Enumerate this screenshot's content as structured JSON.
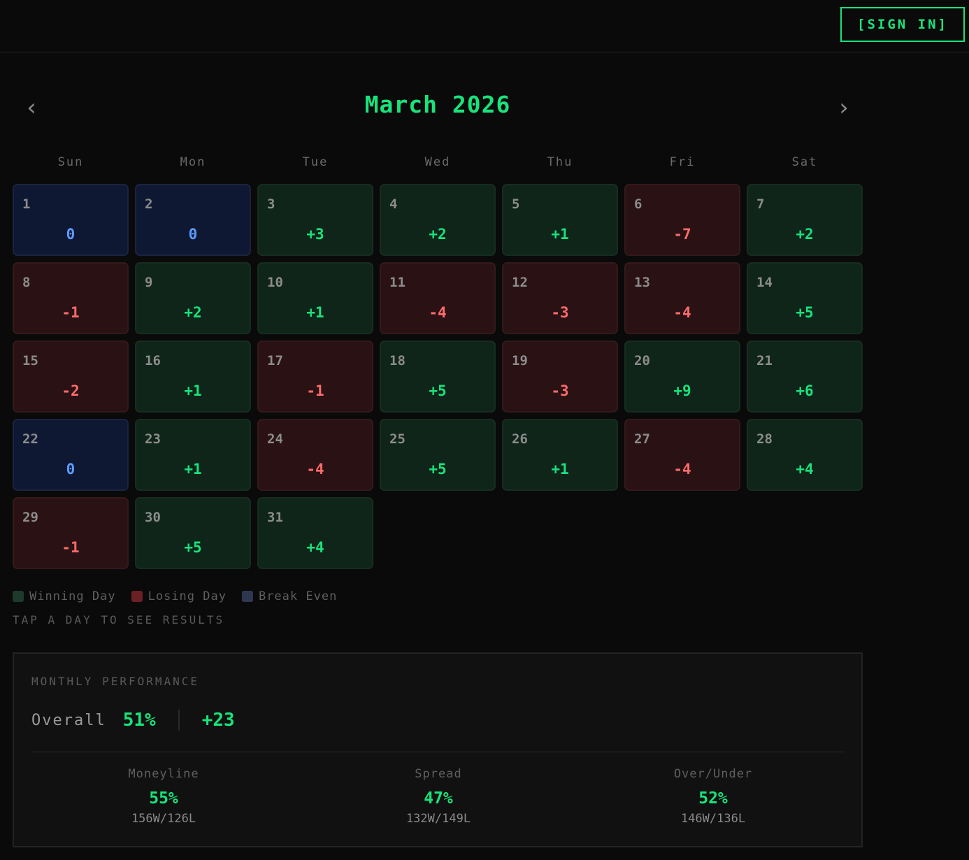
{
  "header": {
    "sign_in_label": "[SIGN IN]"
  },
  "calendar": {
    "title": "March 2026",
    "prev_icon": "‹",
    "next_icon": "›",
    "weekdays": [
      "Sun",
      "Mon",
      "Tue",
      "Wed",
      "Thu",
      "Fri",
      "Sat"
    ],
    "days": [
      {
        "day": "1",
        "value": "0",
        "status": "even"
      },
      {
        "day": "2",
        "value": "0",
        "status": "even"
      },
      {
        "day": "3",
        "value": "+3",
        "status": "win"
      },
      {
        "day": "4",
        "value": "+2",
        "status": "win"
      },
      {
        "day": "5",
        "value": "+1",
        "status": "win"
      },
      {
        "day": "6",
        "value": "-7",
        "status": "loss"
      },
      {
        "day": "7",
        "value": "+2",
        "status": "win"
      },
      {
        "day": "8",
        "value": "-1",
        "status": "loss"
      },
      {
        "day": "9",
        "value": "+2",
        "status": "win"
      },
      {
        "day": "10",
        "value": "+1",
        "status": "win"
      },
      {
        "day": "11",
        "value": "-4",
        "status": "loss"
      },
      {
        "day": "12",
        "value": "-3",
        "status": "loss"
      },
      {
        "day": "13",
        "value": "-4",
        "status": "loss"
      },
      {
        "day": "14",
        "value": "+5",
        "status": "win"
      },
      {
        "day": "15",
        "value": "-2",
        "status": "loss"
      },
      {
        "day": "16",
        "value": "+1",
        "status": "win"
      },
      {
        "day": "17",
        "value": "-1",
        "status": "loss"
      },
      {
        "day": "18",
        "value": "+5",
        "status": "win"
      },
      {
        "day": "19",
        "value": "-3",
        "status": "loss"
      },
      {
        "day": "20",
        "value": "+9",
        "status": "win"
      },
      {
        "day": "21",
        "value": "+6",
        "status": "win"
      },
      {
        "day": "22",
        "value": "0",
        "status": "even"
      },
      {
        "day": "23",
        "value": "+1",
        "status": "win"
      },
      {
        "day": "24",
        "value": "-4",
        "status": "loss"
      },
      {
        "day": "25",
        "value": "+5",
        "status": "win"
      },
      {
        "day": "26",
        "value": "+1",
        "status": "win"
      },
      {
        "day": "27",
        "value": "-4",
        "status": "loss"
      },
      {
        "day": "28",
        "value": "+4",
        "status": "win"
      },
      {
        "day": "29",
        "value": "-1",
        "status": "loss"
      },
      {
        "day": "30",
        "value": "+5",
        "status": "win"
      },
      {
        "day": "31",
        "value": "+4",
        "status": "win"
      }
    ]
  },
  "legend": {
    "winning": "Winning Day",
    "losing": "Losing Day",
    "even": "Break Even"
  },
  "hint": "TAP A DAY TO SEE RESULTS",
  "performance": {
    "title": "MONTHLY PERFORMANCE",
    "overall_label": "Overall",
    "overall_pct": "51%",
    "overall_units": "+23",
    "moneyline": {
      "label": "Moneyline",
      "pct": "55%",
      "record": "156W/126L"
    },
    "spread": {
      "label": "Spread",
      "pct": "47%",
      "record": "132W/149L"
    },
    "over_under": {
      "label": "Over/Under",
      "pct": "52%",
      "record": "146W/136L"
    }
  },
  "colors": {
    "accent": "#19e37b",
    "loss": "#ff6b6b",
    "even": "#5b9bff",
    "background": "#0a0a0a"
  }
}
